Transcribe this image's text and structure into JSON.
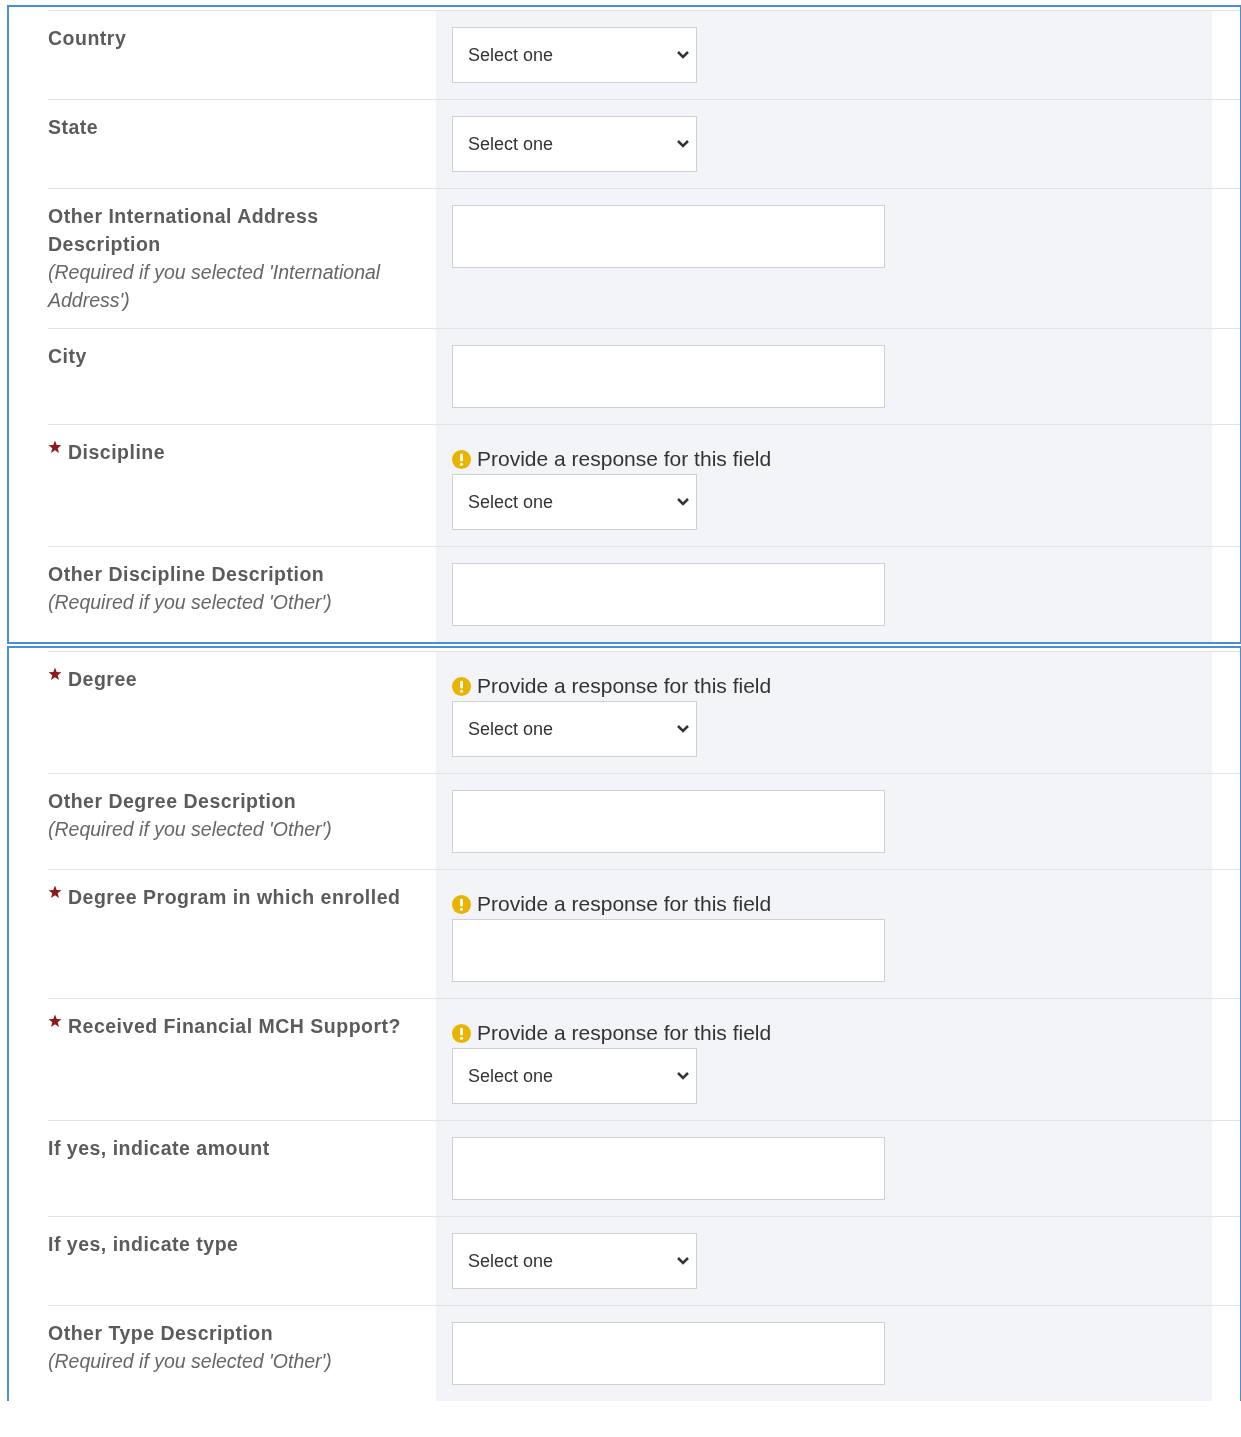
{
  "panels": [
    {
      "rows": [
        {
          "label": "Country",
          "required": false,
          "kind": "select",
          "value": "Select one"
        },
        {
          "label": "State",
          "required": false,
          "kind": "select",
          "value": "Select one"
        },
        {
          "label": "Other International Address Description",
          "hint": "(Required if you selected 'International Address')",
          "required": false,
          "kind": "text"
        },
        {
          "label": "City",
          "required": false,
          "kind": "text"
        },
        {
          "label": "Discipline",
          "required": true,
          "error": "Provide a response for this field",
          "kind": "select",
          "value": "Select one"
        },
        {
          "label": "Other Discipline Description",
          "hint": "(Required if you selected 'Other')",
          "required": false,
          "kind": "text"
        }
      ]
    },
    {
      "rows": [
        {
          "label": "Degree",
          "required": true,
          "error": "Provide a response for this field",
          "kind": "select",
          "value": "Select one"
        },
        {
          "label": "Other Degree Description",
          "hint": "(Required if you selected 'Other')",
          "required": false,
          "kind": "text"
        },
        {
          "label": "Degree Program in which enrolled",
          "required": true,
          "error": "Provide a response for this field",
          "kind": "text"
        },
        {
          "label": "Received Financial MCH Support?",
          "required": true,
          "error": "Provide a response for this field",
          "kind": "select",
          "value": "Select one"
        },
        {
          "label": "If yes, indicate amount",
          "required": false,
          "kind": "text"
        },
        {
          "label": "If yes, indicate type",
          "required": false,
          "kind": "select",
          "value": "Select one"
        },
        {
          "label": "Other Type Description",
          "hint": "(Required if you selected 'Other')",
          "required": false,
          "kind": "text"
        }
      ]
    }
  ]
}
